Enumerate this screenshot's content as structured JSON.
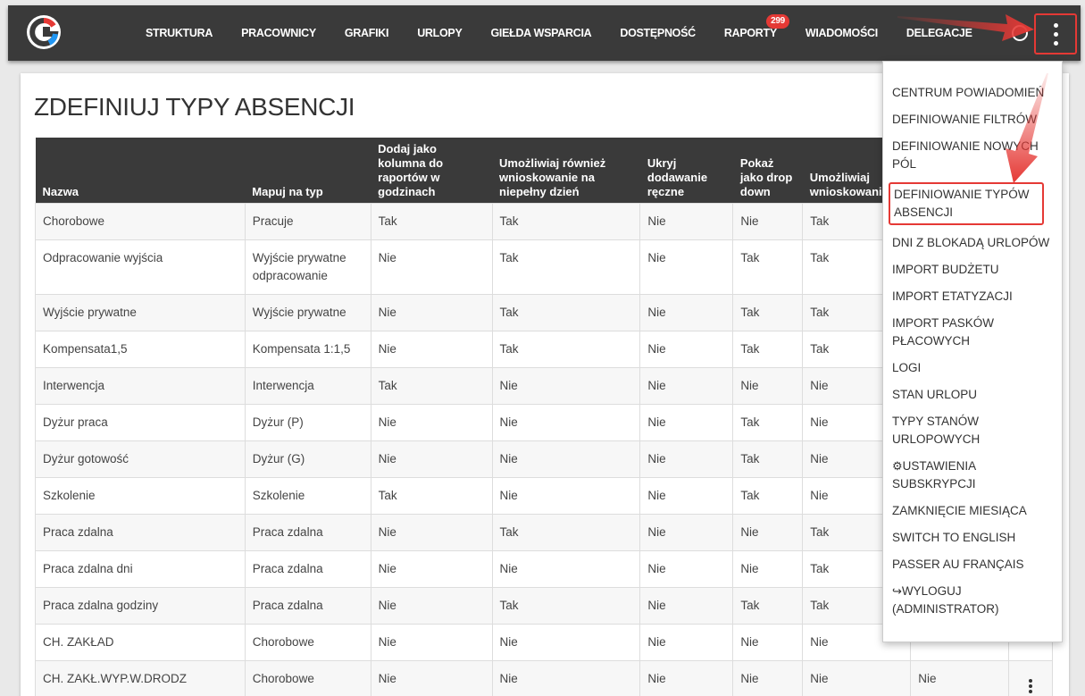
{
  "nav": {
    "items": [
      "STRUKTURA",
      "PRACOWNICY",
      "GRAFIKI",
      "URLOPY",
      "GIEŁDA WSPARCIA",
      "DOSTĘPNOŚĆ",
      "RAPORTY",
      "WIADOMOŚCI",
      "DELEGACJE"
    ],
    "badge": "299"
  },
  "page": {
    "title": "ZDEFINIUJ TYPY ABSENCJI"
  },
  "table": {
    "headers": [
      "Nazwa",
      "Mapuj na typ",
      "Dodaj jako kolumna do raportów w godzinach",
      "Umożliwiaj również wnioskowanie na niepełny dzień",
      "Ukryj dodawanie ręczne",
      "Pokaż jako drop down",
      "Umożliwiaj wnioskowanie",
      ""
    ],
    "rows": [
      [
        "Chorobowe",
        "Pracuje",
        "Tak",
        "Tak",
        "Nie",
        "Nie",
        "Tak",
        ""
      ],
      [
        "Odpracowanie wyjścia",
        "Wyjście prywatne odpracowanie",
        "Nie",
        "Tak",
        "Nie",
        "Tak",
        "Tak",
        ""
      ],
      [
        "Wyjście prywatne",
        "Wyjście prywatne",
        "Nie",
        "Tak",
        "Nie",
        "Tak",
        "Tak",
        ""
      ],
      [
        "Kompensata1,5",
        "Kompensata 1:1,5",
        "Nie",
        "Tak",
        "Nie",
        "Tak",
        "Tak",
        ""
      ],
      [
        "Interwencja",
        "Interwencja",
        "Tak",
        "Nie",
        "Nie",
        "Nie",
        "Nie",
        ""
      ],
      [
        "Dyżur praca",
        "Dyżur (P)",
        "Nie",
        "Nie",
        "Nie",
        "Tak",
        "Nie",
        ""
      ],
      [
        "Dyżur gotowość",
        "Dyżur (G)",
        "Nie",
        "Nie",
        "Nie",
        "Tak",
        "Nie",
        ""
      ],
      [
        "Szkolenie",
        "Szkolenie",
        "Tak",
        "Nie",
        "Nie",
        "Tak",
        "Nie",
        ""
      ],
      [
        "Praca zdalna",
        "Praca zdalna",
        "Nie",
        "Tak",
        "Nie",
        "Nie",
        "Tak",
        ""
      ],
      [
        "Praca zdalna dni",
        "Praca zdalna",
        "Nie",
        "Nie",
        "Nie",
        "Nie",
        "Tak",
        ""
      ],
      [
        "Praca zdalna godziny",
        "Praca zdalna",
        "Nie",
        "Tak",
        "Nie",
        "Tak",
        "Tak",
        ""
      ],
      [
        "CH. ZAKŁAD",
        "Chorobowe",
        "Nie",
        "Nie",
        "Nie",
        "Nie",
        "Nie",
        ""
      ],
      [
        "CH. ZAKŁ.WYP.W.DRODZ",
        "Chorobowe",
        "Nie",
        "Nie",
        "Nie",
        "Nie",
        "Nie",
        "Nie"
      ]
    ]
  },
  "dropdown": {
    "items": [
      "CENTRUM POWIADOMIEŃ",
      "DEFINIOWANIE FILTRÓW",
      "DEFINIOWANIE NOWYCH PÓL",
      "DEFINIOWANIE TYPÓW ABSENCJI",
      "DNI Z BLOKADĄ URLOPÓW",
      "IMPORT BUDŻETU",
      "IMPORT ETATYZACJI",
      "IMPORT PASKÓW PŁACOWYCH",
      "LOGI",
      "STAN URLOPU",
      "TYPY STANÓW URLOPOWYCH",
      "USTAWIENIA SUBSKRYPCJI",
      "ZAMKNIĘCIE MIESIĄCA",
      "SWITCH TO ENGLISH",
      "PASSER AU FRANÇAIS",
      "WYLOGUJ (ADMINISTRATOR)"
    ],
    "highlighted_index": 3,
    "icons": {
      "11": "gear-icon",
      "15": "logout-icon"
    }
  },
  "colors": {
    "topbar": "#3a3a3a",
    "accent": "#e53935"
  }
}
